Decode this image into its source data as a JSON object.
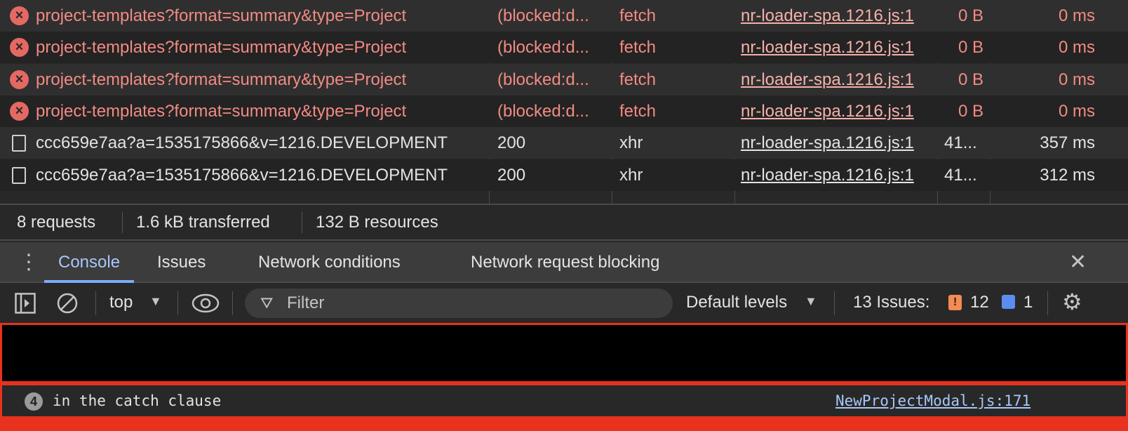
{
  "network": {
    "rows": [
      {
        "name": "project-templates?format=summary&type=Project",
        "status": "(blocked:d...",
        "type": "fetch",
        "initiator": "nr-loader-spa.1216.js:1",
        "size": "0 B",
        "time": "0 ms",
        "error": true
      },
      {
        "name": "project-templates?format=summary&type=Project",
        "status": "(blocked:d...",
        "type": "fetch",
        "initiator": "nr-loader-spa.1216.js:1",
        "size": "0 B",
        "time": "0 ms",
        "error": true
      },
      {
        "name": "project-templates?format=summary&type=Project",
        "status": "(blocked:d...",
        "type": "fetch",
        "initiator": "nr-loader-spa.1216.js:1",
        "size": "0 B",
        "time": "0 ms",
        "error": true
      },
      {
        "name": "project-templates?format=summary&type=Project",
        "status": "(blocked:d...",
        "type": "fetch",
        "initiator": "nr-loader-spa.1216.js:1",
        "size": "0 B",
        "time": "0 ms",
        "error": true
      },
      {
        "name": "ccc659e7aa?a=1535175866&v=1216.DEVELOPMENT",
        "status": "200",
        "type": "xhr",
        "initiator": "nr-loader-spa.1216.js:1",
        "size": "41...",
        "time": "357 ms",
        "error": false
      },
      {
        "name": "ccc659e7aa?a=1535175866&v=1216.DEVELOPMENT",
        "status": "200",
        "type": "xhr",
        "initiator": "nr-loader-spa.1216.js:1",
        "size": "41...",
        "time": "312 ms",
        "error": false
      }
    ],
    "summary": {
      "requests": "8 requests",
      "transferred": "1.6 kB transferred",
      "resources": "132 B resources"
    }
  },
  "drawer": {
    "tabs": [
      "Console",
      "Issues",
      "Network conditions",
      "Network request blocking"
    ],
    "active_tab": "Console"
  },
  "toolbar": {
    "context": "top",
    "filter_placeholder": "Filter",
    "levels": "Default levels",
    "issues_label": "13 Issues:",
    "warn_count": "12",
    "info_count": "1"
  },
  "console": {
    "message_count": "4",
    "message": "in the catch clause",
    "source": "NewProjectModal.js:171"
  },
  "colors": {
    "error": "#f28b82",
    "accent": "#a8c7fa",
    "highlight": "#e8321e",
    "warning": "#f28b54",
    "info": "#5b8def"
  }
}
